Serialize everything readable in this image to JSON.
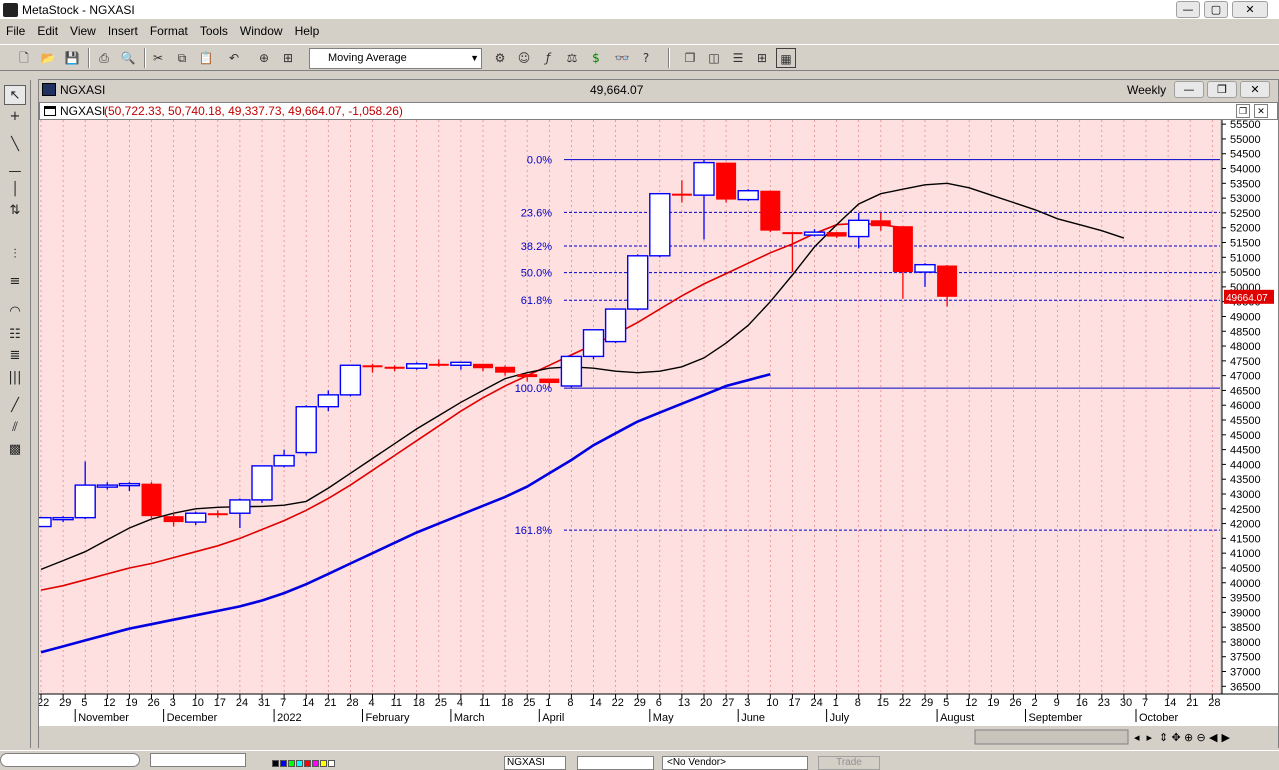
{
  "app": {
    "title": "MetaStock - NGXASI"
  },
  "menu": [
    "File",
    "Edit",
    "View",
    "Insert",
    "Format",
    "Tools",
    "Window",
    "Help"
  ],
  "toolbar": {
    "indicator_select": "Moving Average"
  },
  "document": {
    "title": "NGXASI",
    "last_price": "49,664.07",
    "periodicity": "Weekly"
  },
  "subheader": {
    "symbol": "NGXASI",
    "ohlc": "(50,722.33, 50,740.18, 49,337.73, 49,664.07, -1,058.26)"
  },
  "chart_data": {
    "type": "candlestick",
    "symbol": "NGXASI",
    "periodicity": "weekly",
    "y_ticks": [
      36500,
      37000,
      37500,
      38000,
      38500,
      39000,
      39500,
      40000,
      40500,
      41000,
      41500,
      42000,
      42500,
      43000,
      43500,
      44000,
      44500,
      45000,
      45500,
      46000,
      46500,
      47000,
      47500,
      48000,
      48500,
      49000,
      49500,
      50000,
      50500,
      51000,
      51500,
      52000,
      52500,
      53000,
      53500,
      54000,
      54500,
      55000,
      55500
    ],
    "ylim": [
      36240,
      55640
    ],
    "last_price_label": "49664.07",
    "fibonacci": [
      {
        "label": "0.0%",
        "value": 54300
      },
      {
        "label": "23.6%",
        "value": 52520
      },
      {
        "label": "38.2%",
        "value": 51380
      },
      {
        "label": "50.0%",
        "value": 50480
      },
      {
        "label": "61.8%",
        "value": 49550
      },
      {
        "label": "100.0%",
        "value": 46580
      },
      {
        "label": "161.8%",
        "value": 41780
      }
    ],
    "x_day_labels": [
      "22",
      "29",
      "5",
      "12",
      "19",
      "26",
      "3",
      "10",
      "17",
      "24",
      "31",
      "7",
      "14",
      "21",
      "28",
      "4",
      "11",
      "18",
      "25",
      "4",
      "11",
      "18",
      "25",
      "1",
      "8",
      "14",
      "22",
      "29",
      "6",
      "13",
      "20",
      "27",
      "3",
      "10",
      "17",
      "24",
      "1",
      "8",
      "15",
      "22",
      "29",
      "5",
      "12",
      "19",
      "26",
      "2",
      "9",
      "16",
      "23",
      "30",
      "7",
      "14",
      "21",
      "28"
    ],
    "x_month_labels": [
      {
        "label": "November",
        "index": 2
      },
      {
        "label": "December",
        "index": 6
      },
      {
        "label": "2022",
        "index": 11
      },
      {
        "label": "February",
        "index": 15
      },
      {
        "label": "March",
        "index": 19
      },
      {
        "label": "April",
        "index": 23
      },
      {
        "label": "May",
        "index": 28
      },
      {
        "label": "June",
        "index": 32
      },
      {
        "label": "July",
        "index": 36
      },
      {
        "label": "August",
        "index": 41
      },
      {
        "label": "September",
        "index": 45
      },
      {
        "label": "October",
        "index": 50
      }
    ],
    "candles": [
      {
        "o": 41900,
        "h": 42200,
        "l": 41900,
        "c": 42200
      },
      {
        "o": 42200,
        "h": 42250,
        "l": 42050,
        "c": 42200
      },
      {
        "o": 42200,
        "h": 44100,
        "l": 42150,
        "c": 43300
      },
      {
        "o": 43300,
        "h": 43400,
        "l": 43150,
        "c": 43300
      },
      {
        "o": 43300,
        "h": 43400,
        "l": 43100,
        "c": 43350
      },
      {
        "o": 43350,
        "h": 43400,
        "l": 42150,
        "c": 42250
      },
      {
        "o": 42250,
        "h": 42350,
        "l": 41900,
        "c": 42050
      },
      {
        "o": 42050,
        "h": 42400,
        "l": 41950,
        "c": 42350
      },
      {
        "o": 42350,
        "h": 42450,
        "l": 42200,
        "c": 42300
      },
      {
        "o": 42350,
        "h": 42850,
        "l": 41850,
        "c": 42800
      },
      {
        "o": 42800,
        "h": 43950,
        "l": 42700,
        "c": 43950
      },
      {
        "o": 43950,
        "h": 44500,
        "l": 43900,
        "c": 44300
      },
      {
        "o": 44400,
        "h": 46000,
        "l": 44300,
        "c": 45950
      },
      {
        "o": 45950,
        "h": 46500,
        "l": 45800,
        "c": 46350
      },
      {
        "o": 46350,
        "h": 47350,
        "l": 46300,
        "c": 47350
      },
      {
        "o": 47350,
        "h": 47400,
        "l": 47100,
        "c": 47300
      },
      {
        "o": 47300,
        "h": 47350,
        "l": 47150,
        "c": 47250
      },
      {
        "o": 47250,
        "h": 47450,
        "l": 47200,
        "c": 47400
      },
      {
        "o": 47400,
        "h": 47550,
        "l": 47300,
        "c": 47350
      },
      {
        "o": 47350,
        "h": 47450,
        "l": 47200,
        "c": 47450
      },
      {
        "o": 47400,
        "h": 47400,
        "l": 47150,
        "c": 47250
      },
      {
        "o": 47300,
        "h": 47350,
        "l": 47000,
        "c": 47100
      },
      {
        "o": 47050,
        "h": 47050,
        "l": 46800,
        "c": 46950
      },
      {
        "o": 46900,
        "h": 46900,
        "l": 46600,
        "c": 46750
      },
      {
        "o": 46650,
        "h": 47650,
        "l": 46600,
        "c": 47650
      },
      {
        "o": 47650,
        "h": 48550,
        "l": 47550,
        "c": 48550
      },
      {
        "o": 48150,
        "h": 49250,
        "l": 48100,
        "c": 49250
      },
      {
        "o": 49250,
        "h": 51100,
        "l": 49200,
        "c": 51050
      },
      {
        "o": 51050,
        "h": 53150,
        "l": 51000,
        "c": 53150
      },
      {
        "o": 53150,
        "h": 53600,
        "l": 52850,
        "c": 53100
      },
      {
        "o": 53100,
        "h": 54300,
        "l": 51600,
        "c": 54200
      },
      {
        "o": 54200,
        "h": 54200,
        "l": 52850,
        "c": 52950
      },
      {
        "o": 52950,
        "h": 53300,
        "l": 52900,
        "c": 53250
      },
      {
        "o": 53250,
        "h": 53250,
        "l": 51850,
        "c": 51900
      },
      {
        "o": 51850,
        "h": 51850,
        "l": 50500,
        "c": 51800
      },
      {
        "o": 51750,
        "h": 51950,
        "l": 51700,
        "c": 51850
      },
      {
        "o": 51850,
        "h": 51850,
        "l": 51650,
        "c": 51700
      },
      {
        "o": 51700,
        "h": 52500,
        "l": 51300,
        "c": 52250
      },
      {
        "o": 52250,
        "h": 52500,
        "l": 51900,
        "c": 52050
      },
      {
        "o": 52050,
        "h": 52050,
        "l": 49600,
        "c": 50500
      },
      {
        "o": 50500,
        "h": 50800,
        "l": 50000,
        "c": 50750
      },
      {
        "o": 50722.33,
        "h": 50740.18,
        "l": 49337.73,
        "c": 49664.07
      }
    ],
    "ma_black": [
      40450,
      40750,
      41050,
      41450,
      41850,
      42150,
      42350,
      42500,
      42550,
      42570,
      42580,
      42620,
      42750,
      43200,
      43700,
      44200,
      44700,
      45200,
      45650,
      46100,
      46500,
      46900,
      47100,
      47250,
      47300,
      47250,
      47150,
      47100,
      47150,
      47300,
      47600,
      48100,
      48700,
      49500,
      50400,
      51350,
      52100,
      52800,
      53150,
      53300,
      53450,
      53500,
      53350,
      53100,
      52850,
      52600,
      52300,
      52100,
      51900,
      51650
    ],
    "ma_red": [
      39750,
      39900,
      40100,
      40300,
      40500,
      40650,
      40850,
      41050,
      41250,
      41500,
      41800,
      42100,
      42450,
      42850,
      43300,
      43800,
      44300,
      44800,
      45300,
      45800,
      46250,
      46650,
      47000,
      47350,
      47700,
      48050,
      48400,
      48800,
      49250,
      49700,
      50100,
      50450,
      50800,
      51150,
      51450,
      51800,
      52100,
      52150,
      52100,
      52000
    ],
    "ma_blue": [
      37650,
      37850,
      38050,
      38250,
      38450,
      38600,
      38750,
      38900,
      39050,
      39200,
      39400,
      39650,
      39950,
      40300,
      40650,
      41000,
      41350,
      41700,
      42000,
      42300,
      42600,
      42900,
      43250,
      43700,
      44150,
      44650,
      45050,
      45450,
      45750,
      46050,
      46350,
      46650,
      46850,
      47050
    ]
  },
  "bottom": {
    "symbol_field": "NGXASI",
    "vendor_field": "<No Vendor>",
    "trade_label": "Trade"
  },
  "colors": {
    "chart_bg": "#ffe0e0",
    "up_candle": "#0000ff",
    "down_candle": "#ff0000",
    "fib_line": "#0000c8"
  }
}
